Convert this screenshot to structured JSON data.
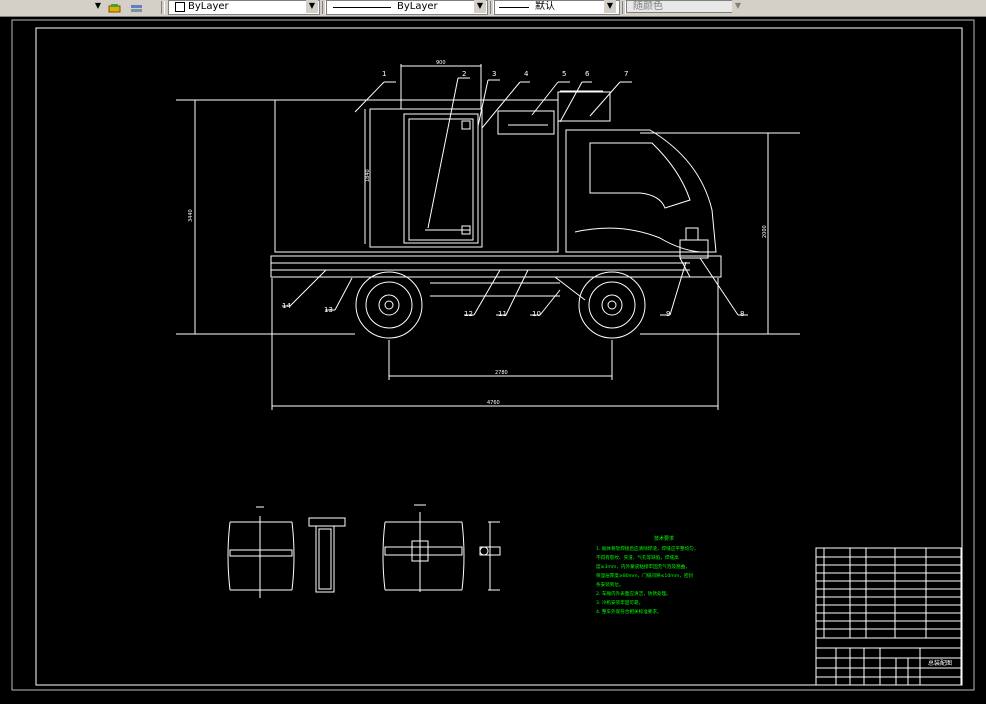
{
  "toolbar": {
    "layer_color_value": "ByLayer",
    "linetype_value": "ByLayer",
    "lineweight_value": "默认",
    "plotstyle_value": "随颜色"
  },
  "drawing": {
    "callouts": [
      "1",
      "2",
      "3",
      "4",
      "5",
      "6",
      "7",
      "8",
      "9",
      "10",
      "11",
      "12",
      "13",
      "14"
    ],
    "dims": {
      "overall_length": "4760",
      "wheelbase": "2780",
      "overall_height": "3440",
      "cab_height": "2000",
      "door_height": "1840",
      "door_width": "900"
    },
    "notes_title": "技术要求",
    "notes": [
      "1. 厢体骨架焊接后应清除焊渣，焊缝应平整均匀，",
      "   不得有裂纹、夹渣、气孔等缺陷，焊缝高",
      "   度≥3mm，内外蒙皮粘接牢固无气泡及翘曲，",
      "   保温层厚度≥80mm，门缝间隙≤10mm，密封",
      "   条安装到位。",
      "2. 车厢内外表面应清洁，防锈处理。",
      "3. 冷机安装牢固可靠。",
      "4. 整车外观符合相关标准要求。"
    ],
    "title_block": {
      "drawing_title": "总装配图"
    }
  },
  "colors": {
    "background": "#000000",
    "lines": "#ffffff",
    "notes": "#00ff00",
    "toolbar": "#d4d0c8"
  }
}
